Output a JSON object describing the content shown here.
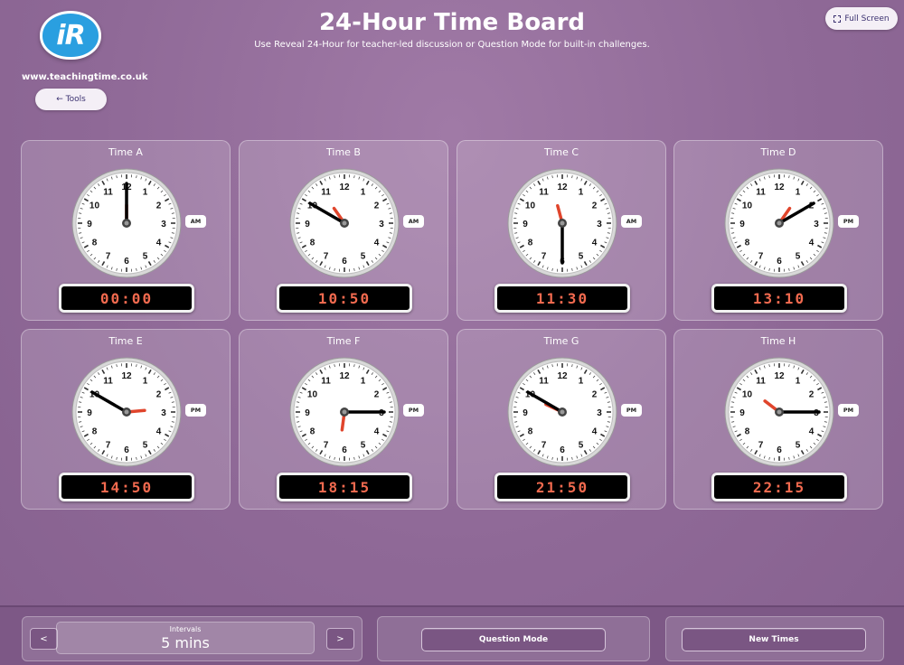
{
  "header": {
    "logo_text": "iR",
    "site_url": "www.teachingtime.co.uk",
    "tools_label": "← Tools",
    "title": "24-Hour Time Board",
    "subtitle": "Use Reveal 24-Hour for teacher-led discussion or Question Mode for built-in challenges.",
    "fullscreen_label": "Full Screen"
  },
  "clocks": [
    {
      "label": "Time A",
      "digital": "00:00",
      "hour": 0,
      "minute": 0,
      "period": "AM"
    },
    {
      "label": "Time B",
      "digital": "10:50",
      "hour": 10,
      "minute": 50,
      "period": "AM"
    },
    {
      "label": "Time C",
      "digital": "11:30",
      "hour": 11,
      "minute": 30,
      "period": "AM"
    },
    {
      "label": "Time D",
      "digital": "13:10",
      "hour": 13,
      "minute": 10,
      "period": "PM"
    },
    {
      "label": "Time E",
      "digital": "14:50",
      "hour": 14,
      "minute": 50,
      "period": "PM"
    },
    {
      "label": "Time F",
      "digital": "18:15",
      "hour": 18,
      "minute": 15,
      "period": "PM"
    },
    {
      "label": "Time G",
      "digital": "21:50",
      "hour": 21,
      "minute": 50,
      "period": "PM"
    },
    {
      "label": "Time H",
      "digital": "22:15",
      "hour": 22,
      "minute": 15,
      "period": "PM"
    }
  ],
  "footer": {
    "prev_label": "<",
    "next_label": ">",
    "intervals_label": "Intervals",
    "intervals_value": "5 mins",
    "question_mode_label": "Question Mode",
    "new_times_label": "New Times"
  },
  "colors": {
    "background": "#8f6997",
    "digital_text": "#f26a4f",
    "hour_hand": "#e0452c",
    "minute_hand": "#000000"
  }
}
